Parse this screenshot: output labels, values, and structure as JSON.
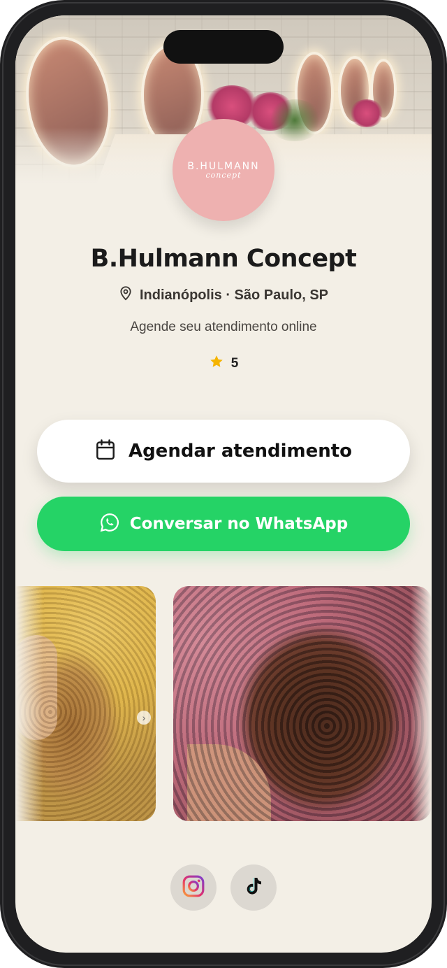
{
  "profile": {
    "name": "B.Hulmann Concept",
    "location": "Indianópolis · São Paulo, SP",
    "tagline": "Agende seu atendimento online",
    "rating": "5"
  },
  "logo": {
    "main": "B.HULMANN",
    "sub": "concept",
    "color": "#eeb1b0"
  },
  "actions": {
    "schedule_label": "Agendar atendimento",
    "whatsapp_label": "Conversar no WhatsApp",
    "whatsapp_color": "#25d366"
  },
  "gallery": {
    "next_icon": "chevron-right-icon"
  },
  "socials": [
    "instagram-icon",
    "tiktok-icon"
  ],
  "colors": {
    "background": "#f3efe6",
    "star": "#f5b400"
  }
}
